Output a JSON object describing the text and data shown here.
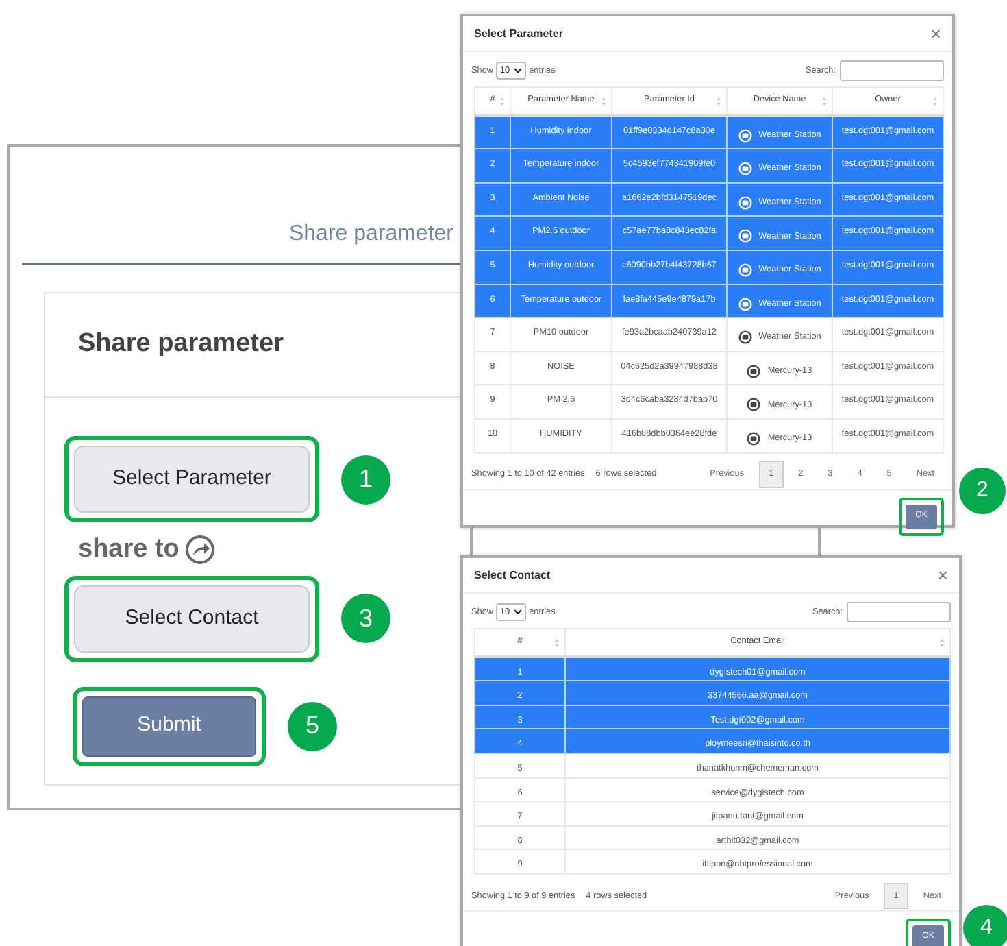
{
  "share_page": {
    "heading": "Share parameter",
    "card_title": "Share parameter",
    "select_parameter_button": {
      "label": "Select Parameter",
      "step": "1"
    },
    "share_to": "share to",
    "select_contact_button": {
      "label": "Select Contact",
      "step": "3"
    },
    "submit_button": {
      "label": "Submit",
      "step": "5"
    }
  },
  "parameter_dialog": {
    "title": "Select Parameter",
    "close": "×",
    "show": "Show",
    "length": "10",
    "entries": "entries",
    "search_label": "Search:",
    "columns": [
      "#",
      "Parameter Name",
      "Parameter Id",
      "Device Name",
      "Owner"
    ],
    "rows": [
      {
        "number": "1",
        "parameter_name": "Humidity indoor",
        "parameter_id": "01ff9e0334d147c8a30e",
        "device_name": "Weather Station",
        "owner": "test.dgt001@gmail.com",
        "selected": true
      },
      {
        "number": "2",
        "parameter_name": "Temperature indoor",
        "parameter_id": "5c4593ef774341909fe0",
        "device_name": "Weather Station",
        "owner": "test.dgt001@gmail.com",
        "selected": true
      },
      {
        "number": "3",
        "parameter_name": "Ambient Noise",
        "parameter_id": "a1662e2bfd3147519dec",
        "device_name": "Weather Station",
        "owner": "test.dgt001@gmail.com",
        "selected": true
      },
      {
        "number": "4",
        "parameter_name": "PM2.5 outdoor",
        "parameter_id": "c57ae77ba8c843ec82fa",
        "device_name": "Weather Station",
        "owner": "test.dgt001@gmail.com",
        "selected": true
      },
      {
        "number": "5",
        "parameter_name": "Humidity outdoor",
        "parameter_id": "c6090bb27b4f43728b67",
        "device_name": "Weather Station",
        "owner": "test.dgt001@gmail.com",
        "selected": true
      },
      {
        "number": "6",
        "parameter_name": "Temperature outdoor",
        "parameter_id": "fae8fa445e9e4879a17b",
        "device_name": "Weather Station",
        "owner": "test.dgt001@gmail.com",
        "selected": true
      },
      {
        "number": "7",
        "parameter_name": "PM10 outdoor",
        "parameter_id": "fe93a2bcaab240739a12",
        "device_name": "Weather Station",
        "owner": "test.dgt001@gmail.com",
        "selected": false
      },
      {
        "number": "8",
        "parameter_name": "NOISE",
        "parameter_id": "04c625d2a39947988d38",
        "device_name": "Mercury-13",
        "owner": "test.dgt001@gmail.com",
        "selected": false
      },
      {
        "number": "9",
        "parameter_name": "PM 2.5",
        "parameter_id": "3d4c6caba3284d7bab70",
        "device_name": "Mercury-13",
        "owner": "test.dgt001@gmail.com",
        "selected": false
      },
      {
        "number": "10",
        "parameter_name": "HUMIDITY",
        "parameter_id": "416b08dbb0364ee28fde",
        "device_name": "Mercury-13",
        "owner": "test.dgt001@gmail.com",
        "selected": false
      }
    ],
    "info": "Showing 1 to 10 of 42 entries",
    "selection_info": "6 rows selected",
    "previous": "Previous",
    "pages": [
      {
        "label": "1",
        "selected": true
      },
      {
        "label": "2",
        "selected": false
      },
      {
        "label": "3",
        "selected": false
      },
      {
        "label": "4",
        "selected": false
      },
      {
        "label": "5",
        "selected": false
      }
    ],
    "next": "Next",
    "ok_button": {
      "label": "OK",
      "step": "2"
    }
  },
  "contact_dialog": {
    "title": "Select Contact",
    "close": "×",
    "show": "Show",
    "length": "10",
    "entries": "entries",
    "search_label": "Search:",
    "columns": [
      "#",
      "Contact Email"
    ],
    "rows": [
      {
        "number": "1",
        "email": "dygistech01@gmail.com",
        "selected": true
      },
      {
        "number": "2",
        "email": "33744566.aa@gmail.com",
        "selected": true
      },
      {
        "number": "3",
        "email": "Test.dgt002@gmail.com",
        "selected": true
      },
      {
        "number": "4",
        "email": "ploymeesri@thaisinto.co.th",
        "selected": true
      },
      {
        "number": "5",
        "email": "thanatkhunm@chememan.com",
        "selected": false
      },
      {
        "number": "6",
        "email": "service@dygistech.com",
        "selected": false
      },
      {
        "number": "7",
        "email": "jitpanu.tant@gmail.com",
        "selected": false
      },
      {
        "number": "8",
        "email": "arthit032@gmail.com",
        "selected": false
      },
      {
        "number": "9",
        "email": "ittipon@nbtprofessional.com",
        "selected": false
      }
    ],
    "info": "Showing 1 to 9 of 9 entries",
    "selection_info": "4 rows selected",
    "previous": "Previous",
    "pages": [
      {
        "label": "1",
        "selected": true
      }
    ],
    "next": "Next",
    "ok_button": {
      "label": "OK",
      "step": "4"
    }
  }
}
